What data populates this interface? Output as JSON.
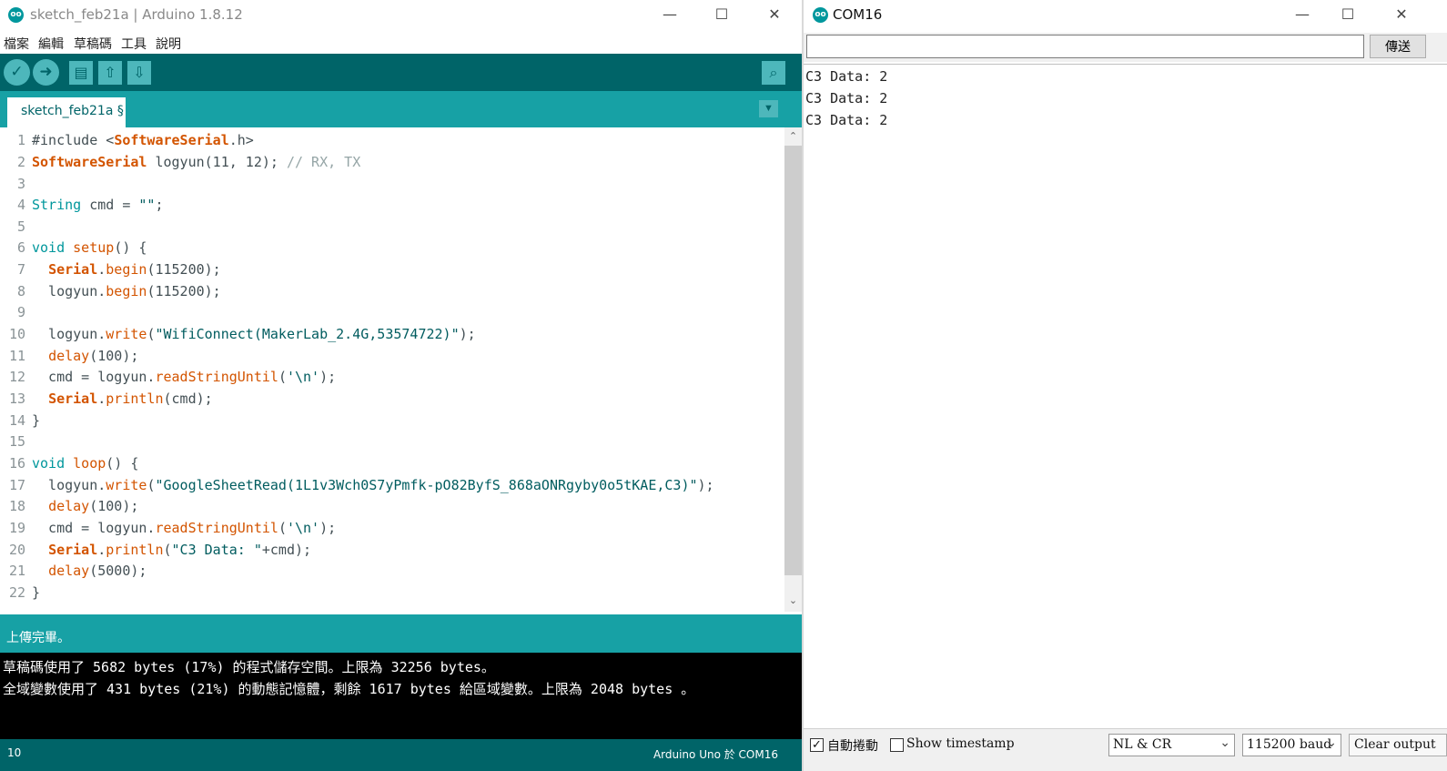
{
  "ide": {
    "title": "sketch_feb21a | Arduino 1.8.12",
    "logo_text": "oo",
    "window_controls": {
      "minimize": "—",
      "maximize": "☐",
      "close": "✕"
    },
    "menu": [
      "檔案",
      "編輯",
      "草稿碼",
      "工具",
      "說明"
    ],
    "toolbar": {
      "verify_icon": "✓",
      "upload_icon": "➜",
      "new_icon": "▤",
      "open_icon": "⇧",
      "save_icon": "⇩",
      "serial_monitor_icon": "⌕"
    },
    "tab_label": "sketch_feb21a §",
    "tab_menu_icon": "▼",
    "code_lines": [
      {
        "n": "1"
      },
      {
        "n": "2"
      },
      {
        "n": "3"
      },
      {
        "n": "4"
      },
      {
        "n": "5"
      },
      {
        "n": "6"
      },
      {
        "n": "7"
      },
      {
        "n": "8"
      },
      {
        "n": "9"
      },
      {
        "n": "10"
      },
      {
        "n": "11"
      },
      {
        "n": "12"
      },
      {
        "n": "13"
      },
      {
        "n": "14"
      },
      {
        "n": "15"
      },
      {
        "n": "16"
      },
      {
        "n": "17"
      },
      {
        "n": "18"
      },
      {
        "n": "19"
      },
      {
        "n": "20"
      },
      {
        "n": "21"
      },
      {
        "n": "22"
      }
    ],
    "code": {
      "l1a": "#include <",
      "l1b": "SoftwareSerial",
      "l1c": ".h>",
      "l2a": "SoftwareSerial",
      "l2b": " logyun(11, 12); ",
      "l2c": "// RX, TX",
      "l4a": "String",
      "l4b": " cmd = ",
      "l4c": "\"\"",
      "l4d": ";",
      "l6a": "void",
      "l6b": " ",
      "l6c": "setup",
      "l6d": "() {",
      "l7a": "  ",
      "l7b": "Serial",
      "l7c": ".",
      "l7d": "begin",
      "l7e": "(115200);",
      "l8a": "  logyun.",
      "l8b": "begin",
      "l8c": "(115200);",
      "l10a": "  logyun.",
      "l10b": "write",
      "l10c": "(",
      "l10d": "\"WifiConnect(MakerLab_2.4G,53574722)\"",
      "l10e": ");",
      "l11a": "  ",
      "l11b": "delay",
      "l11c": "(100);",
      "l12a": "  cmd = logyun.",
      "l12b": "readStringUntil",
      "l12c": "(",
      "l12d": "'\\n'",
      "l12e": ");",
      "l13a": "  ",
      "l13b": "Serial",
      "l13c": ".",
      "l13d": "println",
      "l13e": "(cmd);",
      "l14a": "}",
      "l16a": "void",
      "l16b": " ",
      "l16c": "loop",
      "l16d": "() {",
      "l17a": "  logyun.",
      "l17b": "write",
      "l17c": "(",
      "l17d": "\"GoogleSheetRead(1L1v3Wch0S7yPmfk-pO82ByfS_868aONRgyby0o5tKAE,C3)\"",
      "l17e": ");",
      "l18a": "  ",
      "l18b": "delay",
      "l18c": "(100);",
      "l19a": "  cmd = logyun.",
      "l19b": "readStringUntil",
      "l19c": "(",
      "l19d": "'\\n'",
      "l19e": ");",
      "l20a": "  ",
      "l20b": "Serial",
      "l20c": ".",
      "l20d": "println",
      "l20e": "(",
      "l20f": "\"C3 Data: \"",
      "l20g": "+cmd);",
      "l21a": "  ",
      "l21b": "delay",
      "l21c": "(5000);",
      "l22a": "}"
    },
    "scroll_up_icon": "⌃",
    "scroll_down_icon": "⌄",
    "status_message": "上傳完畢。",
    "console_lines": [
      "草稿碼使用了 5682 bytes (17%) 的程式儲存空間。上限為 32256 bytes。",
      "全域變數使用了 431 bytes (21%) 的動態記憶體，剩餘 1617 bytes 給區域變數。上限為 2048 bytes 。"
    ],
    "footer_line": "10",
    "footer_board": "Arduino Uno 於 COM16"
  },
  "serial": {
    "title": "COM16",
    "logo_text": "oo",
    "window_controls": {
      "minimize": "—",
      "maximize": "☐",
      "close": "✕"
    },
    "input_value": "",
    "send_label": "傳送",
    "output_lines": [
      "C3 Data: 2",
      "C3 Data: 2",
      "C3 Data: 2"
    ],
    "autoscroll_checked": "✓",
    "autoscroll_label": "自動捲動",
    "timestamp_checked": "",
    "timestamp_label": "Show timestamp",
    "line_ending": "NL & CR",
    "baud_rate": "115200 baud",
    "select_caret": "⌄",
    "clear_label": "Clear output"
  },
  "colors": {
    "toolbar": "#006468",
    "tabbar": "#17a1a5",
    "keyword_type": "#00979c",
    "keyword_function": "#d35400",
    "string": "#005c5f",
    "comment": "#95a5a6"
  }
}
